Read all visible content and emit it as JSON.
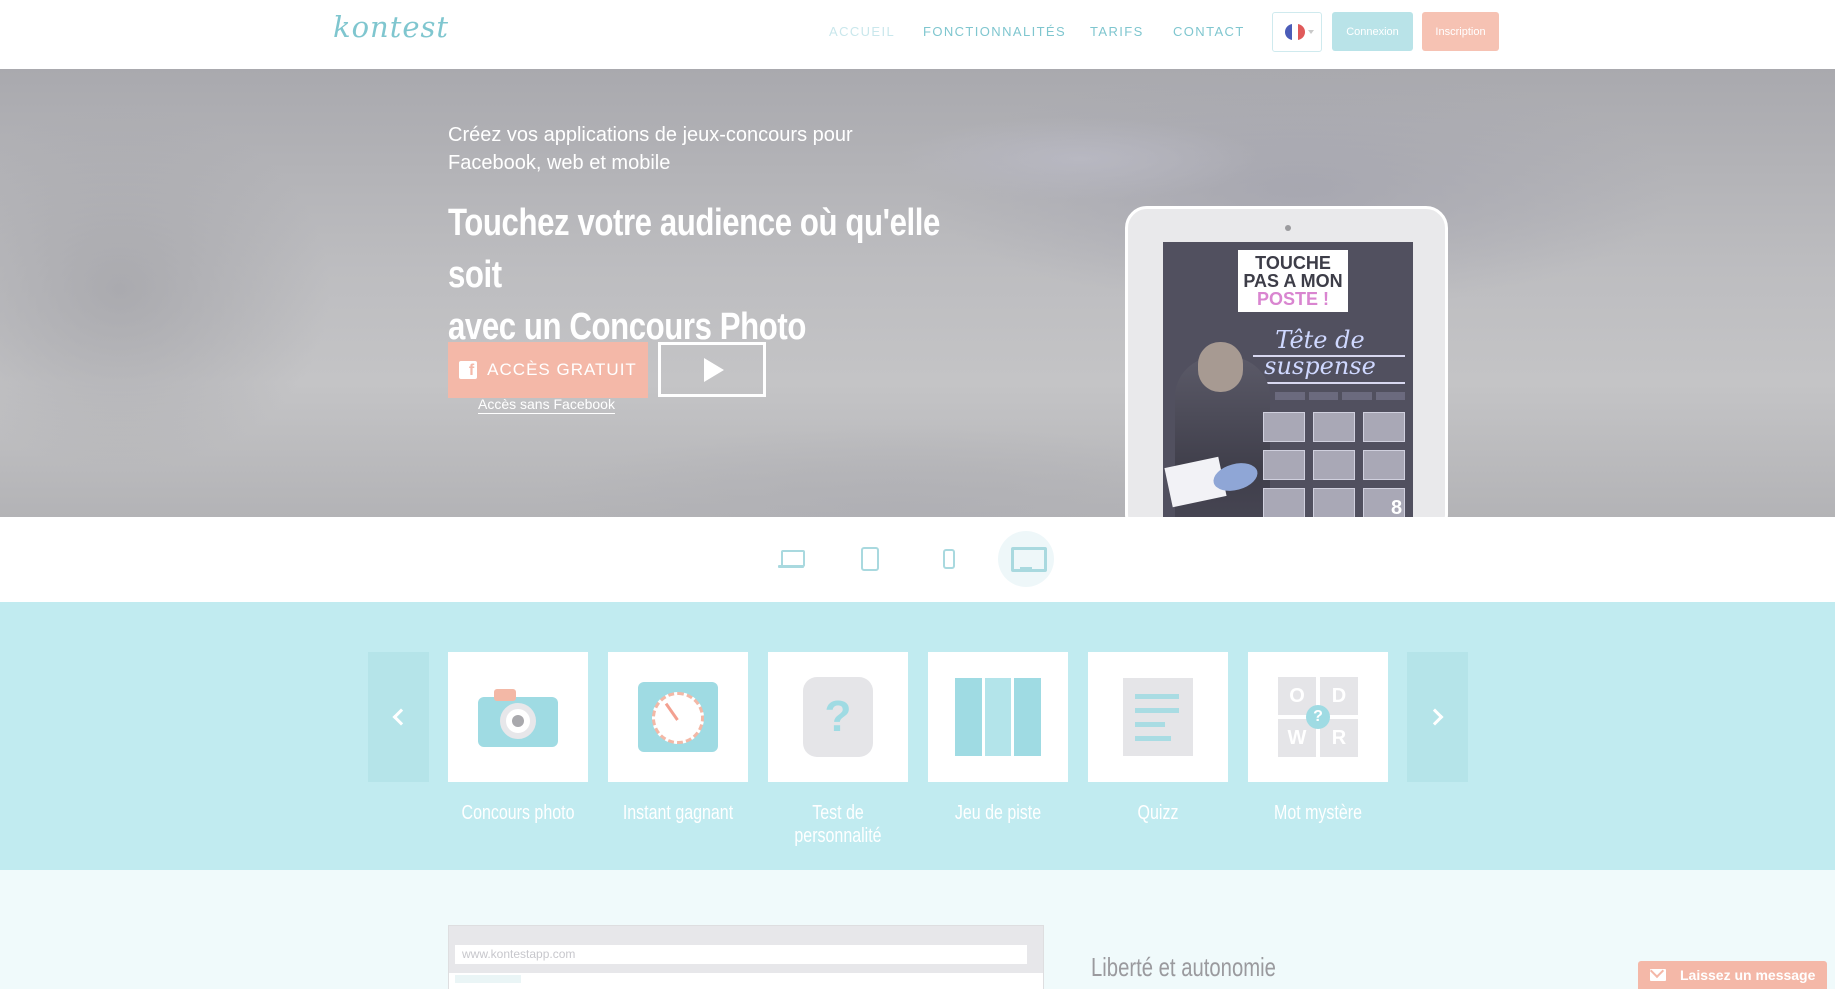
{
  "header": {
    "logo": "kontest",
    "nav": [
      "ACCUEIL",
      "FONCTIONNALITÉS",
      "TARIFS",
      "CONTACT"
    ],
    "flag_colors": [
      "#4b5cb8",
      "#ffffff",
      "#e05a5a"
    ],
    "login_label": "Connexion",
    "signup_label": "Inscription"
  },
  "hero": {
    "subtitle": "Créez vos applications de jeux-concours pour Facebook, web et mobile",
    "title_line1": "Touchez votre audience où qu'elle soit",
    "title_line2": "avec un Concours Photo",
    "cta_label": "ACCÈS GRATUIT",
    "cta_icon": "f",
    "alt_link": "Accès sans Facebook",
    "video_icon": "play-icon"
  },
  "tablet_screen": {
    "logo_line1": "TOUCHE",
    "logo_line2": "PAS A MON",
    "logo_line3": "POSTE !",
    "headline_line1": "Tête de",
    "headline_line2": "suspense",
    "channel_number": "8"
  },
  "devices": [
    "laptop-icon",
    "tablet-icon",
    "phone-icon",
    "desktop-icon"
  ],
  "active_device": "desktop-icon",
  "features": {
    "items": [
      {
        "label": "Concours photo",
        "icon": "camera-icon"
      },
      {
        "label": "Instant gagnant",
        "icon": "clock-icon"
      },
      {
        "label": "Test de personnalité",
        "icon": "personality-icon"
      },
      {
        "label": "Jeu de piste",
        "icon": "map-icon"
      },
      {
        "label": "Quizz",
        "icon": "quiz-icon"
      },
      {
        "label": "Mot mystère",
        "icon": "word-grid-icon"
      }
    ],
    "word_letters": [
      "O",
      "D",
      "W",
      "R"
    ],
    "question_mark": "?"
  },
  "bottom": {
    "url": "www.kontestapp.com",
    "heading": "Liberté et autonomie"
  },
  "chat": {
    "label": "Laissez un message"
  },
  "colors": {
    "accent_teal": "#7fc6cf",
    "band": "#c1ebf0",
    "accent_salmon": "#f4b8a8"
  }
}
